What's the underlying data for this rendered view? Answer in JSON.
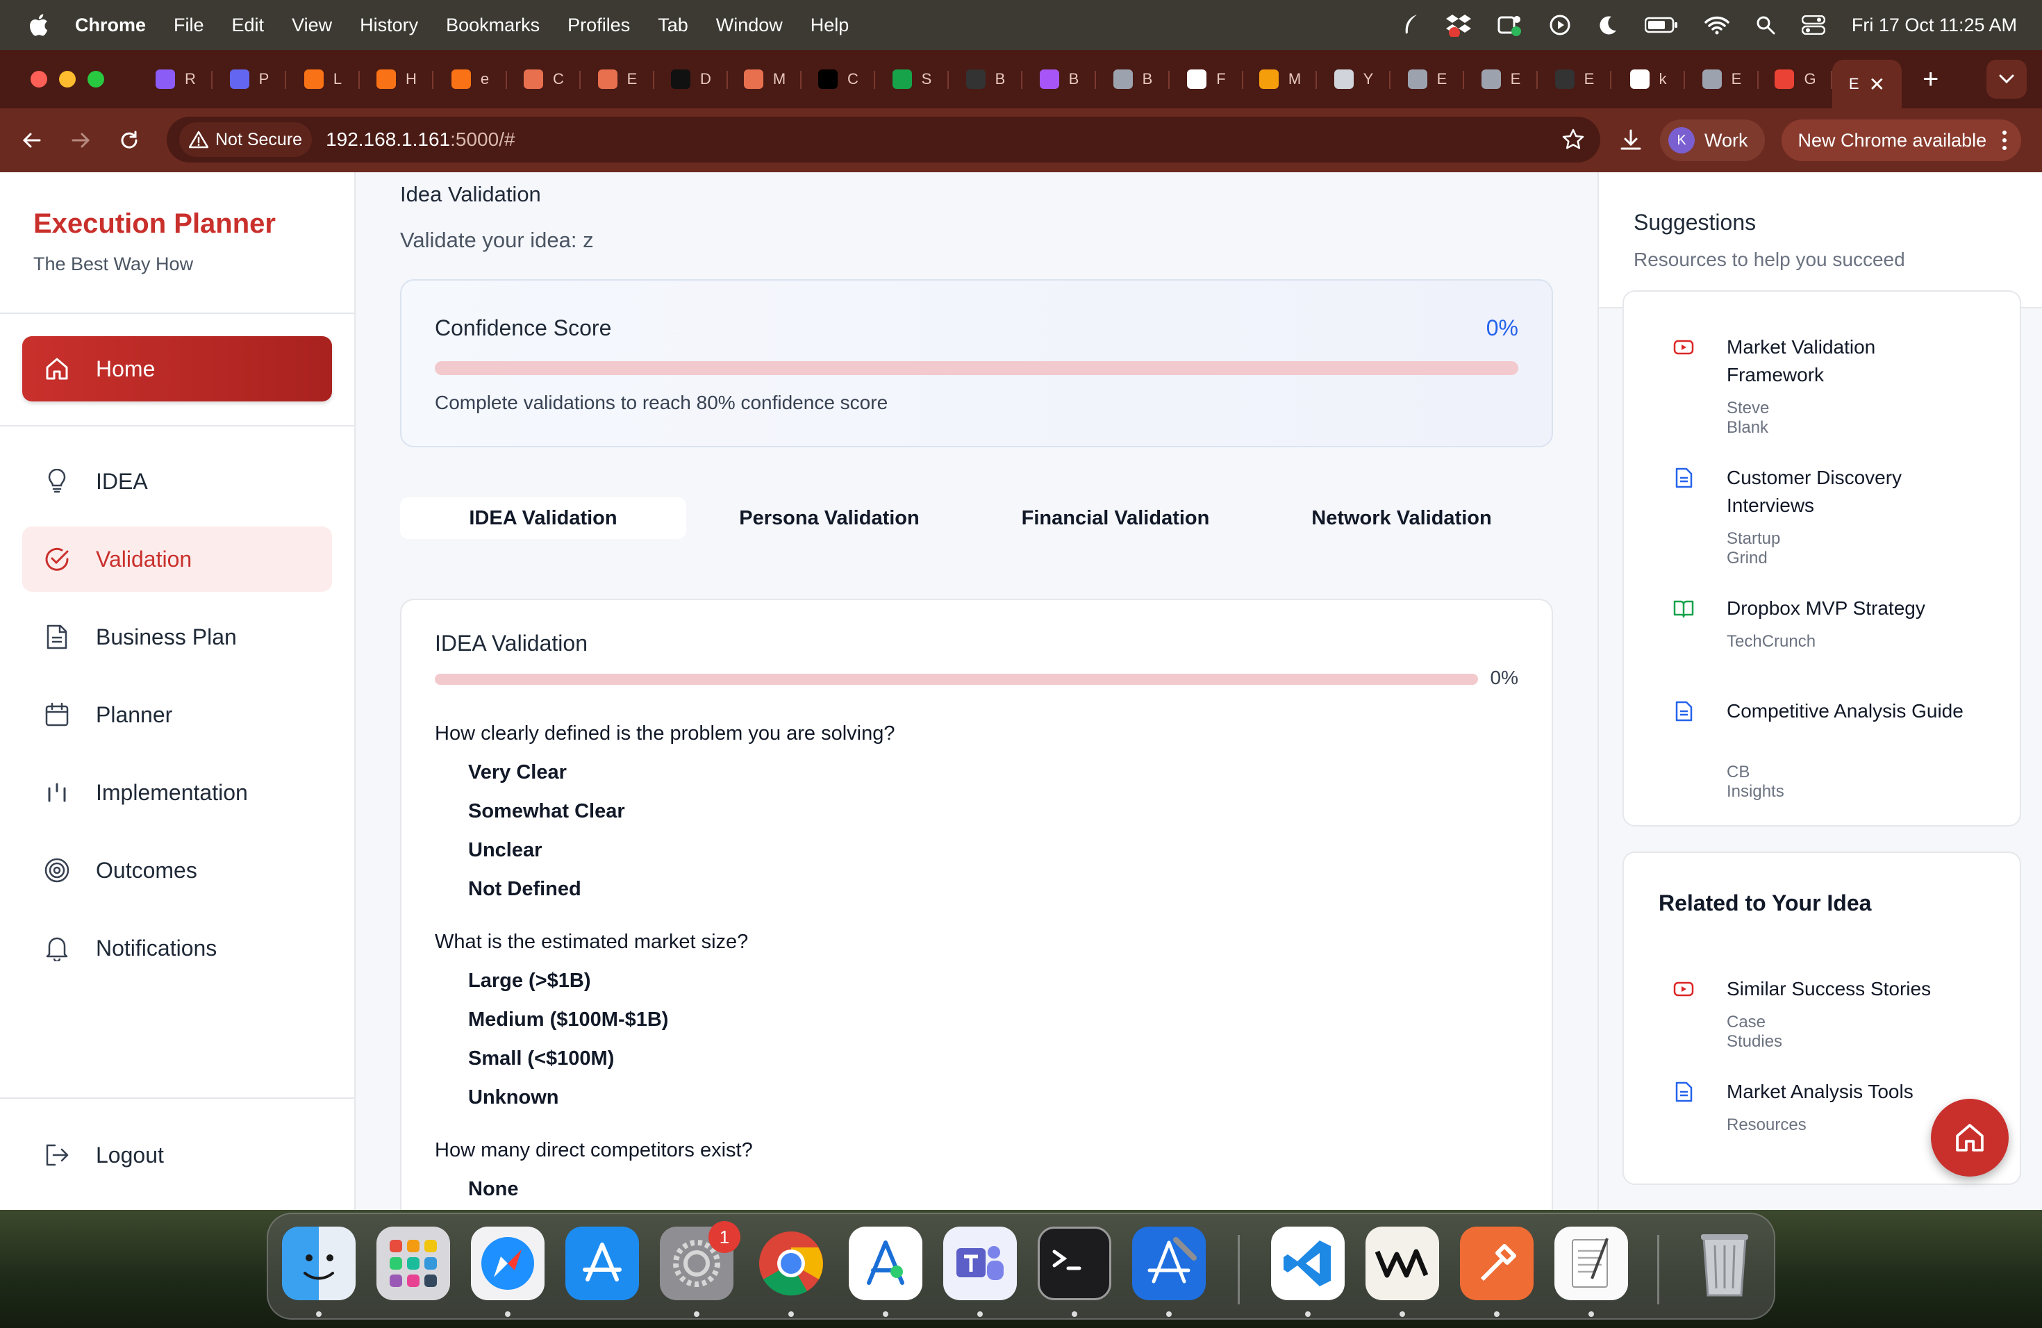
{
  "menubar": {
    "app_name": "Chrome",
    "items": [
      "File",
      "Edit",
      "View",
      "History",
      "Bookmarks",
      "Profiles",
      "Tab",
      "Window",
      "Help"
    ],
    "clock": "Fri 17 Oct  11:25 AM",
    "status_icons": [
      "feather-icon",
      "dropbox-icon",
      "teams-status-icon",
      "play-icon",
      "moon-icon",
      "battery-icon",
      "wifi-icon",
      "search-icon",
      "control-center-icon"
    ]
  },
  "tabs": [
    {
      "letter": "R",
      "color": "#8b5cf6"
    },
    {
      "letter": "P",
      "color": "#6366f1"
    },
    {
      "letter": "L",
      "color": "#f97316"
    },
    {
      "letter": "H",
      "color": "#f97316"
    },
    {
      "letter": "e",
      "color": "#f97316"
    },
    {
      "letter": "C",
      "color": "#e8704f"
    },
    {
      "letter": "E",
      "color": "#e8704f"
    },
    {
      "letter": "D",
      "color": "#111111"
    },
    {
      "letter": "M",
      "color": "#e8704f"
    },
    {
      "letter": "C",
      "color": "#000000"
    },
    {
      "letter": "S",
      "color": "#16a34a"
    },
    {
      "letter": "B",
      "color": "#333333"
    },
    {
      "letter": "B",
      "color": "#a855f7"
    },
    {
      "letter": "B",
      "color": "#9ca3af"
    },
    {
      "letter": "F",
      "color": "#ffffff"
    },
    {
      "letter": "M",
      "color": "#f59e0b"
    },
    {
      "letter": "Y",
      "color": "#d1d5db"
    },
    {
      "letter": "E",
      "color": "#9ca3af"
    },
    {
      "letter": "E",
      "color": "#9ca3af"
    },
    {
      "letter": "E",
      "color": "#333333"
    },
    {
      "letter": "k",
      "color": "#ffffff"
    },
    {
      "letter": "E",
      "color": "#9ca3af"
    },
    {
      "letter": "G",
      "color": "#ea4335"
    }
  ],
  "active_tab": {
    "letter": "E",
    "close": "✕"
  },
  "new_tab": "+",
  "toolbar": {
    "security": "Not Secure",
    "url_host": "192.168.1.161",
    "url_rest": ":5000/#",
    "profile_initial": "K",
    "profile_name": "Work",
    "update_label": "New Chrome available"
  },
  "sidebar": {
    "brand_title": "Execution Planner",
    "brand_sub": "The Best Way How",
    "home": "Home",
    "items": [
      {
        "label": "IDEA",
        "icon": "lightbulb-icon"
      },
      {
        "label": "Validation",
        "icon": "check-circle-icon"
      },
      {
        "label": "Business Plan",
        "icon": "document-icon"
      },
      {
        "label": "Planner",
        "icon": "calendar-icon"
      },
      {
        "label": "Implementation",
        "icon": "bars-icon"
      },
      {
        "label": "Outcomes",
        "icon": "target-icon"
      },
      {
        "label": "Notifications",
        "icon": "bell-icon"
      }
    ],
    "logout": "Logout"
  },
  "main": {
    "heading": "Idea Validation",
    "subheading": "Validate your idea: z",
    "confidence": {
      "title": "Confidence Score",
      "value": "0%",
      "progress": 0,
      "note": "Complete validations to reach 80% confidence score"
    },
    "tabs": [
      "IDEA Validation",
      "Persona Validation",
      "Financial Validation",
      "Network Validation"
    ],
    "section": {
      "title": "IDEA Validation",
      "percent": "0%",
      "progress": 0,
      "questions": [
        {
          "q": "How clearly defined is the problem you are solving?",
          "options": [
            "Very Clear",
            "Somewhat Clear",
            "Unclear",
            "Not Defined"
          ]
        },
        {
          "q": "What is the estimated market size?",
          "options": [
            "Large (>$1B)",
            "Medium ($100M-$1B)",
            "Small (<$100M)",
            "Unknown"
          ]
        },
        {
          "q": "How many direct competitors exist?",
          "options": [
            "None"
          ]
        }
      ]
    }
  },
  "suggestions": {
    "title": "Suggestions",
    "subtitle": "Resources to help you succeed",
    "resources": [
      {
        "title": "Market Validation Framework",
        "source": "Steve Blank",
        "icon": "video-icon"
      },
      {
        "title": "Customer Discovery Interviews",
        "source": "Startup Grind",
        "icon": "article-icon"
      },
      {
        "title": "Dropbox MVP Strategy",
        "source": "TechCrunch",
        "icon": "book-icon"
      },
      {
        "title": "Competitive Analysis Guide",
        "source": "CB Insights",
        "icon": "article-icon"
      }
    ],
    "related_title": "Related to Your Idea",
    "related": [
      {
        "title": "Similar Success Stories",
        "source": "Case Studies",
        "icon": "video-icon"
      },
      {
        "title": "Market Analysis Tools",
        "source": "Resources",
        "icon": "article-icon"
      }
    ]
  },
  "dock": {
    "apps": [
      "Finder",
      "Launchpad",
      "Safari",
      "App Store",
      "System Settings",
      "Chrome",
      "Instruments",
      "Teams",
      "Terminal",
      "Xcode",
      "VS Code",
      "Warp",
      "Postman",
      "TextEdit",
      "Trash"
    ],
    "settings_badge": "1"
  },
  "colors": {
    "accent": "#c9302c",
    "score_blue": "#2563eb"
  }
}
